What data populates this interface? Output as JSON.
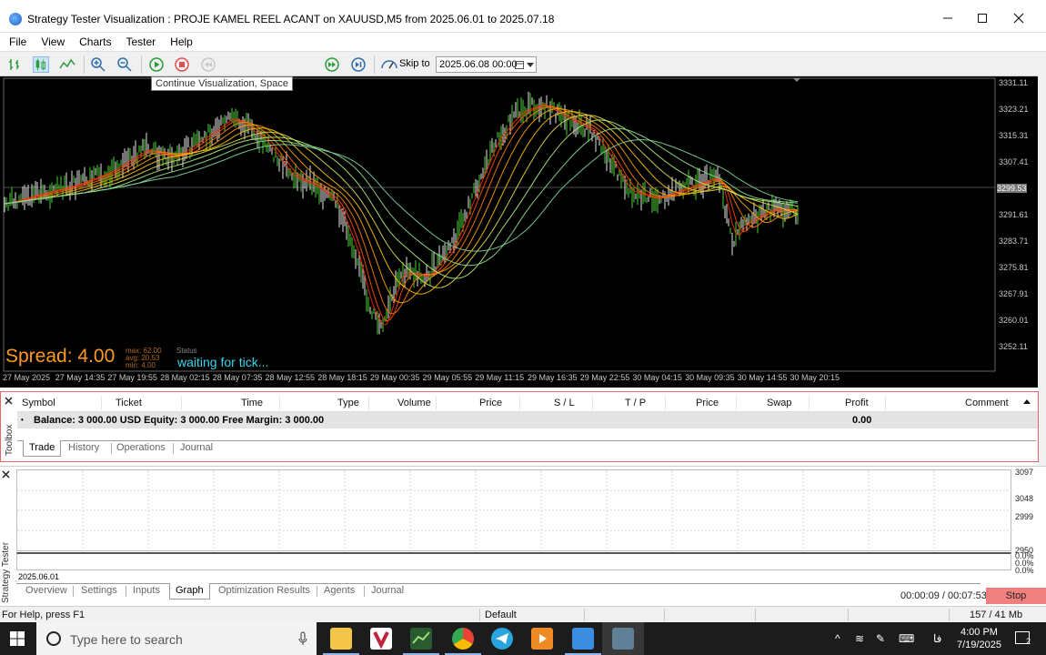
{
  "window": {
    "title": "Strategy Tester Visualization : PROJE KAMEL REEL ACANT on XAUUSD,M5 from 2025.06.01 to 2025.07.18",
    "min_icon": "minimize-icon",
    "max_icon": "maximize-icon",
    "close_icon": "close-icon"
  },
  "menu": [
    "File",
    "View",
    "Charts",
    "Tester",
    "Help"
  ],
  "toolbar": {
    "skip_to_label": "Skip to",
    "skip_to_value": "2025.06.08 00:00",
    "tooltip": "Continue Visualization, Space"
  },
  "chart": {
    "price_labels": [
      "3331.11",
      "3323.21",
      "3315.31",
      "3307.41",
      "3299.53",
      "3291.61",
      "3283.71",
      "3275.81",
      "3267.91",
      "3260.01",
      "3252.11"
    ],
    "time_labels": [
      "27 May 2025",
      "27 May 14:35",
      "27 May 19:55",
      "28 May 02:15",
      "28 May 07:35",
      "28 May 12:55",
      "28 May 18:15",
      "29 May 00:35",
      "29 May 05:55",
      "29 May 11:15",
      "29 May 16:35",
      "29 May 22:55",
      "30 May 04:15",
      "30 May 09:35",
      "30 May 14:55",
      "30 May 20:15"
    ],
    "spread_text": "Spread: 4.00",
    "spread_stats": [
      "max: 62.00",
      "avg: 20.53",
      "min: 4.00"
    ],
    "status_label": "Status",
    "status_text": "waiting for tick..."
  },
  "toolbox": {
    "side_label": "Toolbox",
    "columns": [
      "Symbol",
      "Ticket",
      "Time",
      "Type",
      "Volume",
      "Price",
      "S / L",
      "T / P",
      "Price",
      "Swap",
      "Profit",
      "Comment"
    ],
    "balance_text": "Balance: 3 000.00 USD  Equity: 3 000.00  Free Margin: 3 000.00",
    "profit_value": "0.00",
    "tabs": [
      "Trade",
      "History",
      "Operations",
      "Journal"
    ],
    "active_tab": "Trade"
  },
  "tester": {
    "side_label": "Strategy Tester",
    "graph_labels": [
      "3097",
      "3048",
      "2999",
      "2950"
    ],
    "percent_labels": [
      "0.0%",
      "0.0%",
      "0.0%"
    ],
    "start_date": "2025.06.01",
    "tabs": [
      "Overview",
      "Settings",
      "Inputs",
      "Graph",
      "Optimization Results",
      "Agents",
      "Journal"
    ],
    "active_tab": "Graph",
    "timer": "00:00:09 / 00:07:53",
    "stop_label": "Stop"
  },
  "statusbar": {
    "help": "For Help, press F1",
    "profile": "Default",
    "memory": "157 / 41 Mb"
  },
  "taskbar": {
    "search_placeholder": "Type here to search",
    "time": "4:00 PM",
    "date": "7/19/2025",
    "notification_count": "2",
    "lang": "فا"
  }
}
